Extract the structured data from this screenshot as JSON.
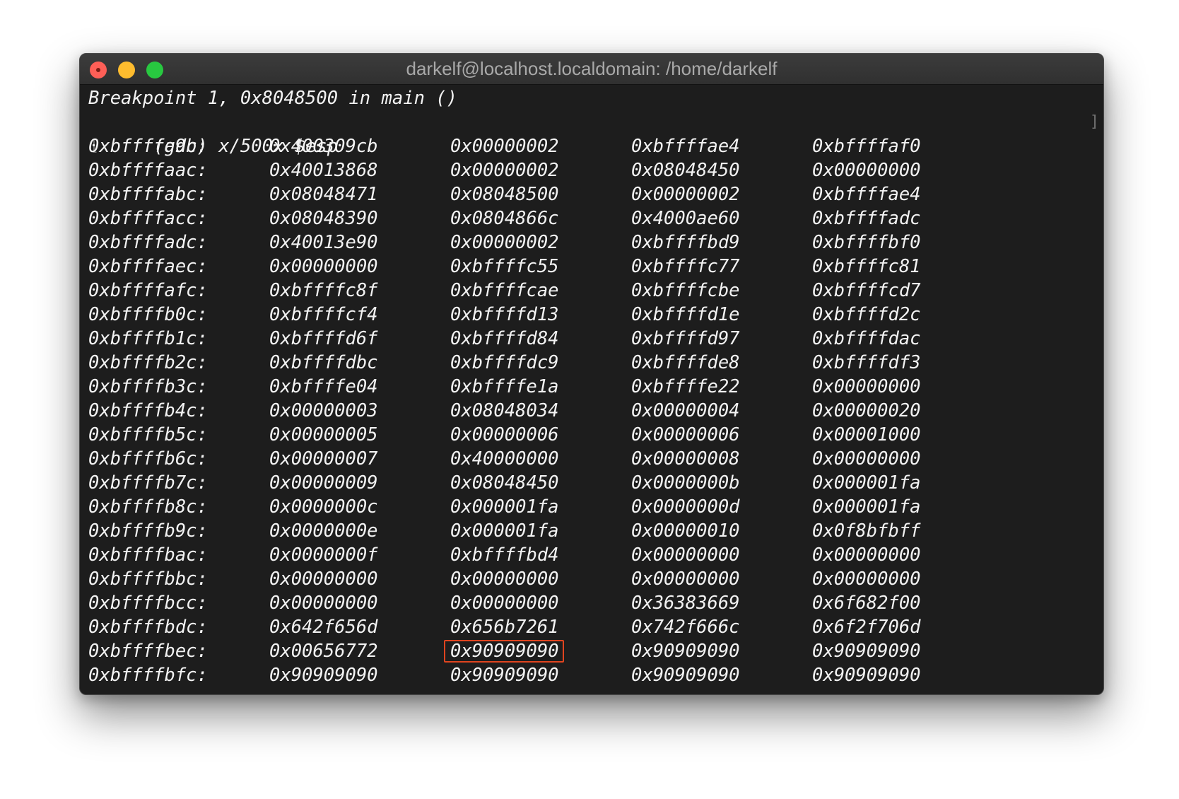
{
  "window": {
    "title": "darkelf@localhost.localdomain: /home/darkelf"
  },
  "terminal": {
    "header_lines": [
      "Breakpoint 1, 0x8048500 in main ()",
      "(gdb) x/500x $esp"
    ],
    "memory_rows": [
      {
        "address": "0xbffffa9c:",
        "words": [
          "0x400309cb",
          "0x00000002",
          "0xbffffae4",
          "0xbffffaf0"
        ]
      },
      {
        "address": "0xbffffaac:",
        "words": [
          "0x40013868",
          "0x00000002",
          "0x08048450",
          "0x00000000"
        ]
      },
      {
        "address": "0xbffffabc:",
        "words": [
          "0x08048471",
          "0x08048500",
          "0x00000002",
          "0xbffffae4"
        ]
      },
      {
        "address": "0xbffffacc:",
        "words": [
          "0x08048390",
          "0x0804866c",
          "0x4000ae60",
          "0xbffffadc"
        ]
      },
      {
        "address": "0xbffffadc:",
        "words": [
          "0x40013e90",
          "0x00000002",
          "0xbffffbd9",
          "0xbffffbf0"
        ]
      },
      {
        "address": "0xbffffaec:",
        "words": [
          "0x00000000",
          "0xbffffc55",
          "0xbffffc77",
          "0xbffffc81"
        ]
      },
      {
        "address": "0xbffffafc:",
        "words": [
          "0xbffffc8f",
          "0xbffffcae",
          "0xbffffcbe",
          "0xbffffcd7"
        ]
      },
      {
        "address": "0xbffffb0c:",
        "words": [
          "0xbffffcf4",
          "0xbffffd13",
          "0xbffffd1e",
          "0xbffffd2c"
        ]
      },
      {
        "address": "0xbffffb1c:",
        "words": [
          "0xbffffd6f",
          "0xbffffd84",
          "0xbffffd97",
          "0xbffffdac"
        ]
      },
      {
        "address": "0xbffffb2c:",
        "words": [
          "0xbffffdbc",
          "0xbffffdc9",
          "0xbffffde8",
          "0xbffffdf3"
        ]
      },
      {
        "address": "0xbffffb3c:",
        "words": [
          "0xbffffe04",
          "0xbffffe1a",
          "0xbffffe22",
          "0x00000000"
        ]
      },
      {
        "address": "0xbffffb4c:",
        "words": [
          "0x00000003",
          "0x08048034",
          "0x00000004",
          "0x00000020"
        ]
      },
      {
        "address": "0xbffffb5c:",
        "words": [
          "0x00000005",
          "0x00000006",
          "0x00000006",
          "0x00001000"
        ]
      },
      {
        "address": "0xbffffb6c:",
        "words": [
          "0x00000007",
          "0x40000000",
          "0x00000008",
          "0x00000000"
        ]
      },
      {
        "address": "0xbffffb7c:",
        "words": [
          "0x00000009",
          "0x08048450",
          "0x0000000b",
          "0x000001fa"
        ]
      },
      {
        "address": "0xbffffb8c:",
        "words": [
          "0x0000000c",
          "0x000001fa",
          "0x0000000d",
          "0x000001fa"
        ]
      },
      {
        "address": "0xbffffb9c:",
        "words": [
          "0x0000000e",
          "0x000001fa",
          "0x00000010",
          "0x0f8bfbff"
        ]
      },
      {
        "address": "0xbffffbac:",
        "words": [
          "0x0000000f",
          "0xbffffbd4",
          "0x00000000",
          "0x00000000"
        ]
      },
      {
        "address": "0xbffffbbc:",
        "words": [
          "0x00000000",
          "0x00000000",
          "0x00000000",
          "0x00000000"
        ]
      },
      {
        "address": "0xbffffbcc:",
        "words": [
          "0x00000000",
          "0x00000000",
          "0x36383669",
          "0x6f682f00"
        ]
      },
      {
        "address": "0xbffffbdc:",
        "words": [
          "0x642f656d",
          "0x656b7261",
          "0x742f666c",
          "0x6f2f706d"
        ]
      },
      {
        "address": "0xbffffbec:",
        "words": [
          "0x00656772",
          "0x90909090",
          "0x90909090",
          "0x90909090"
        ]
      },
      {
        "address": "0xbffffbfc:",
        "words": [
          "0x90909090",
          "0x90909090",
          "0x90909090",
          "0x90909090"
        ]
      }
    ],
    "highlighted_cell": {
      "row": 21,
      "word": 1
    },
    "highlight_color": "#e0441f"
  },
  "colors": {
    "background": "#1d1d1d",
    "text": "#f2f2f2",
    "close": "#fe5f57",
    "minimize": "#febc2e",
    "maximize": "#28c840"
  }
}
